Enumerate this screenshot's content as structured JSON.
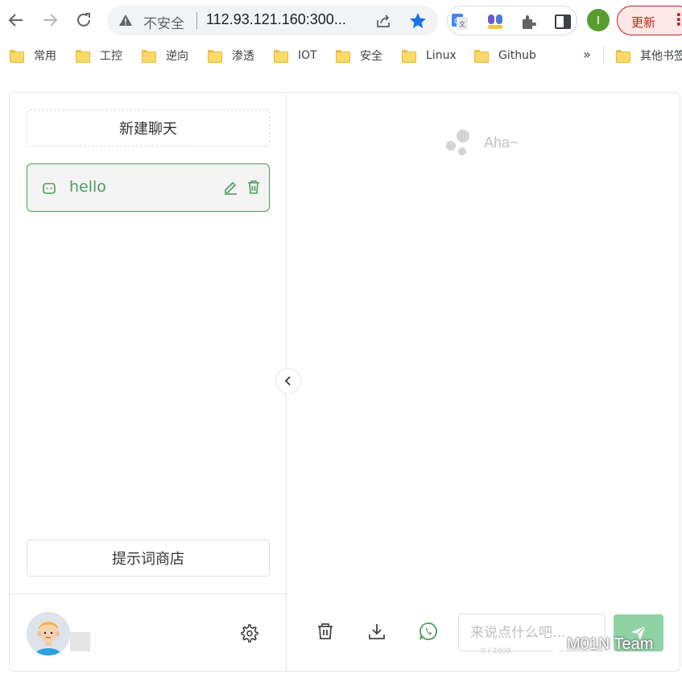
{
  "browser": {
    "omnibox": {
      "security_label": "不安全",
      "url": "112.93.121.160:300..."
    },
    "profile_initial": "I",
    "update_label": "更新",
    "update_menu": "⋮",
    "bookmarks": [
      "常用",
      "工控",
      "逆向",
      "渗透",
      "IOT",
      "安全",
      "Linux",
      "Github"
    ],
    "bookmarks_more": "»",
    "other_bookmarks": "其他书签"
  },
  "sidebar": {
    "new_chat_label": "新建聊天",
    "chats": [
      {
        "title": "hello"
      }
    ],
    "prompt_store_label": "提示词商店"
  },
  "main": {
    "empty_state_text": "Aha~",
    "input_placeholder": "来说点什么吧...",
    "input_value": "",
    "input_counter": "0 / 2000"
  },
  "watermark": "M01N Team",
  "colors": {
    "accent_green": "#4b9e5f",
    "send_button": "#8fd3a5",
    "update_red": "#c5221f",
    "bookmark_star": "#1a73e8"
  }
}
